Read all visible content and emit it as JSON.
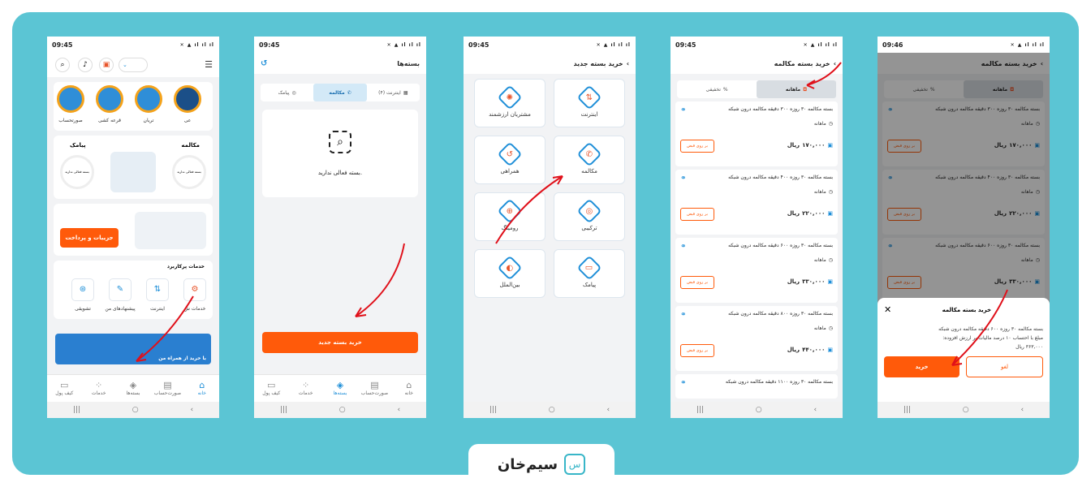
{
  "status_time": [
    "09:45",
    "09:45",
    "09:45",
    "09:45",
    "09:46"
  ],
  "status_icons": "✕ ▲ ıl ıl ıl",
  "colors": {
    "frame": "#5bc5d4",
    "accent": "#ff5a0a",
    "primary": "#1f8fd8"
  },
  "phone1": {
    "stories": [
      "عی",
      "تریان",
      "قرعه کشی",
      "صورتحساب"
    ],
    "usage_left": "مکالمه",
    "usage_right": "پیامک",
    "no_active": "بسته فعالی ندارید",
    "details_button": "جزییات و پرداخت",
    "services_title": "خدمات پرکاربرد",
    "services": [
      "خدمات ش",
      "اینترنت",
      "پیشنهادهای من",
      "تشویقی"
    ],
    "banner_text": "با خرید از همراه من"
  },
  "nav": [
    "خانه",
    "صورت‌حساب",
    "بسته‌ها",
    "خدمات",
    "کیف پول"
  ],
  "phone2": {
    "title": "بسته‌ها",
    "tabs": [
      "اینترنت (۴)",
      "مکالمه",
      "پیامک"
    ],
    "empty_text": "بسته فعالی ندارید.",
    "buy_button": "خرید بسته جدید"
  },
  "phone3": {
    "title": "خرید بسته جدید",
    "tiles": [
      "اینترنت",
      "مشتریان ارزشمند",
      "مکالمه",
      "همراهی",
      "ترکیبی",
      "رومینگ",
      "پیامک",
      "بین‌الملل"
    ],
    "tile_icons": [
      "⇅",
      "✺",
      "✆",
      "↺",
      "◎",
      "⊕",
      "▭",
      "◐"
    ]
  },
  "phone4": {
    "title": "خرید بسته مکالمه",
    "tabs": [
      "ماهانه",
      "تخفیفی"
    ],
    "monthly": "ماهانه",
    "bill_button": "بر روی قبض",
    "currency": "ریال",
    "packages": [
      {
        "title": "بسته مکالمه ۳۰ روزه ۳۰۰ دقیقه مکالمه درون شبکه",
        "price": "۱۷۰,۰۰۰"
      },
      {
        "title": "بسته مکالمه ۳۰ روزه ۴۰۰ دقیقه مکالمه درون شبکه",
        "price": "۲۲۰,۰۰۰"
      },
      {
        "title": "بسته مکالمه ۳۰ روزه ۶۰۰ دقیقه مکالمه درون شبکه",
        "price": "۳۳۰,۰۰۰"
      },
      {
        "title": "بسته مکالمه ۳۰ روزه ۸۰۰ دقیقه مکالمه درون شبکه",
        "price": "۴۴۰,۰۰۰"
      },
      {
        "title": "بسته مکالمه ۳۰ روزه ۱۱۰۰ دقیقه مکالمه درون شبکه",
        "price": ""
      }
    ]
  },
  "phone5": {
    "sheet_title": "خرید بسته مکالمه",
    "sheet_body1": "بسته مکالمه ۳۰ روزه ۶۰۰ دقیقه مکالمه درون شبکه",
    "sheet_body2": "مبلغ با احتساب ۱۰ درصد مالیات بر ارزش افزوده:",
    "sheet_price": "۳۶۳,۰۰۰ ریال",
    "cancel": "لغو",
    "buy": "خرید"
  },
  "brand": "سیم‌خان"
}
